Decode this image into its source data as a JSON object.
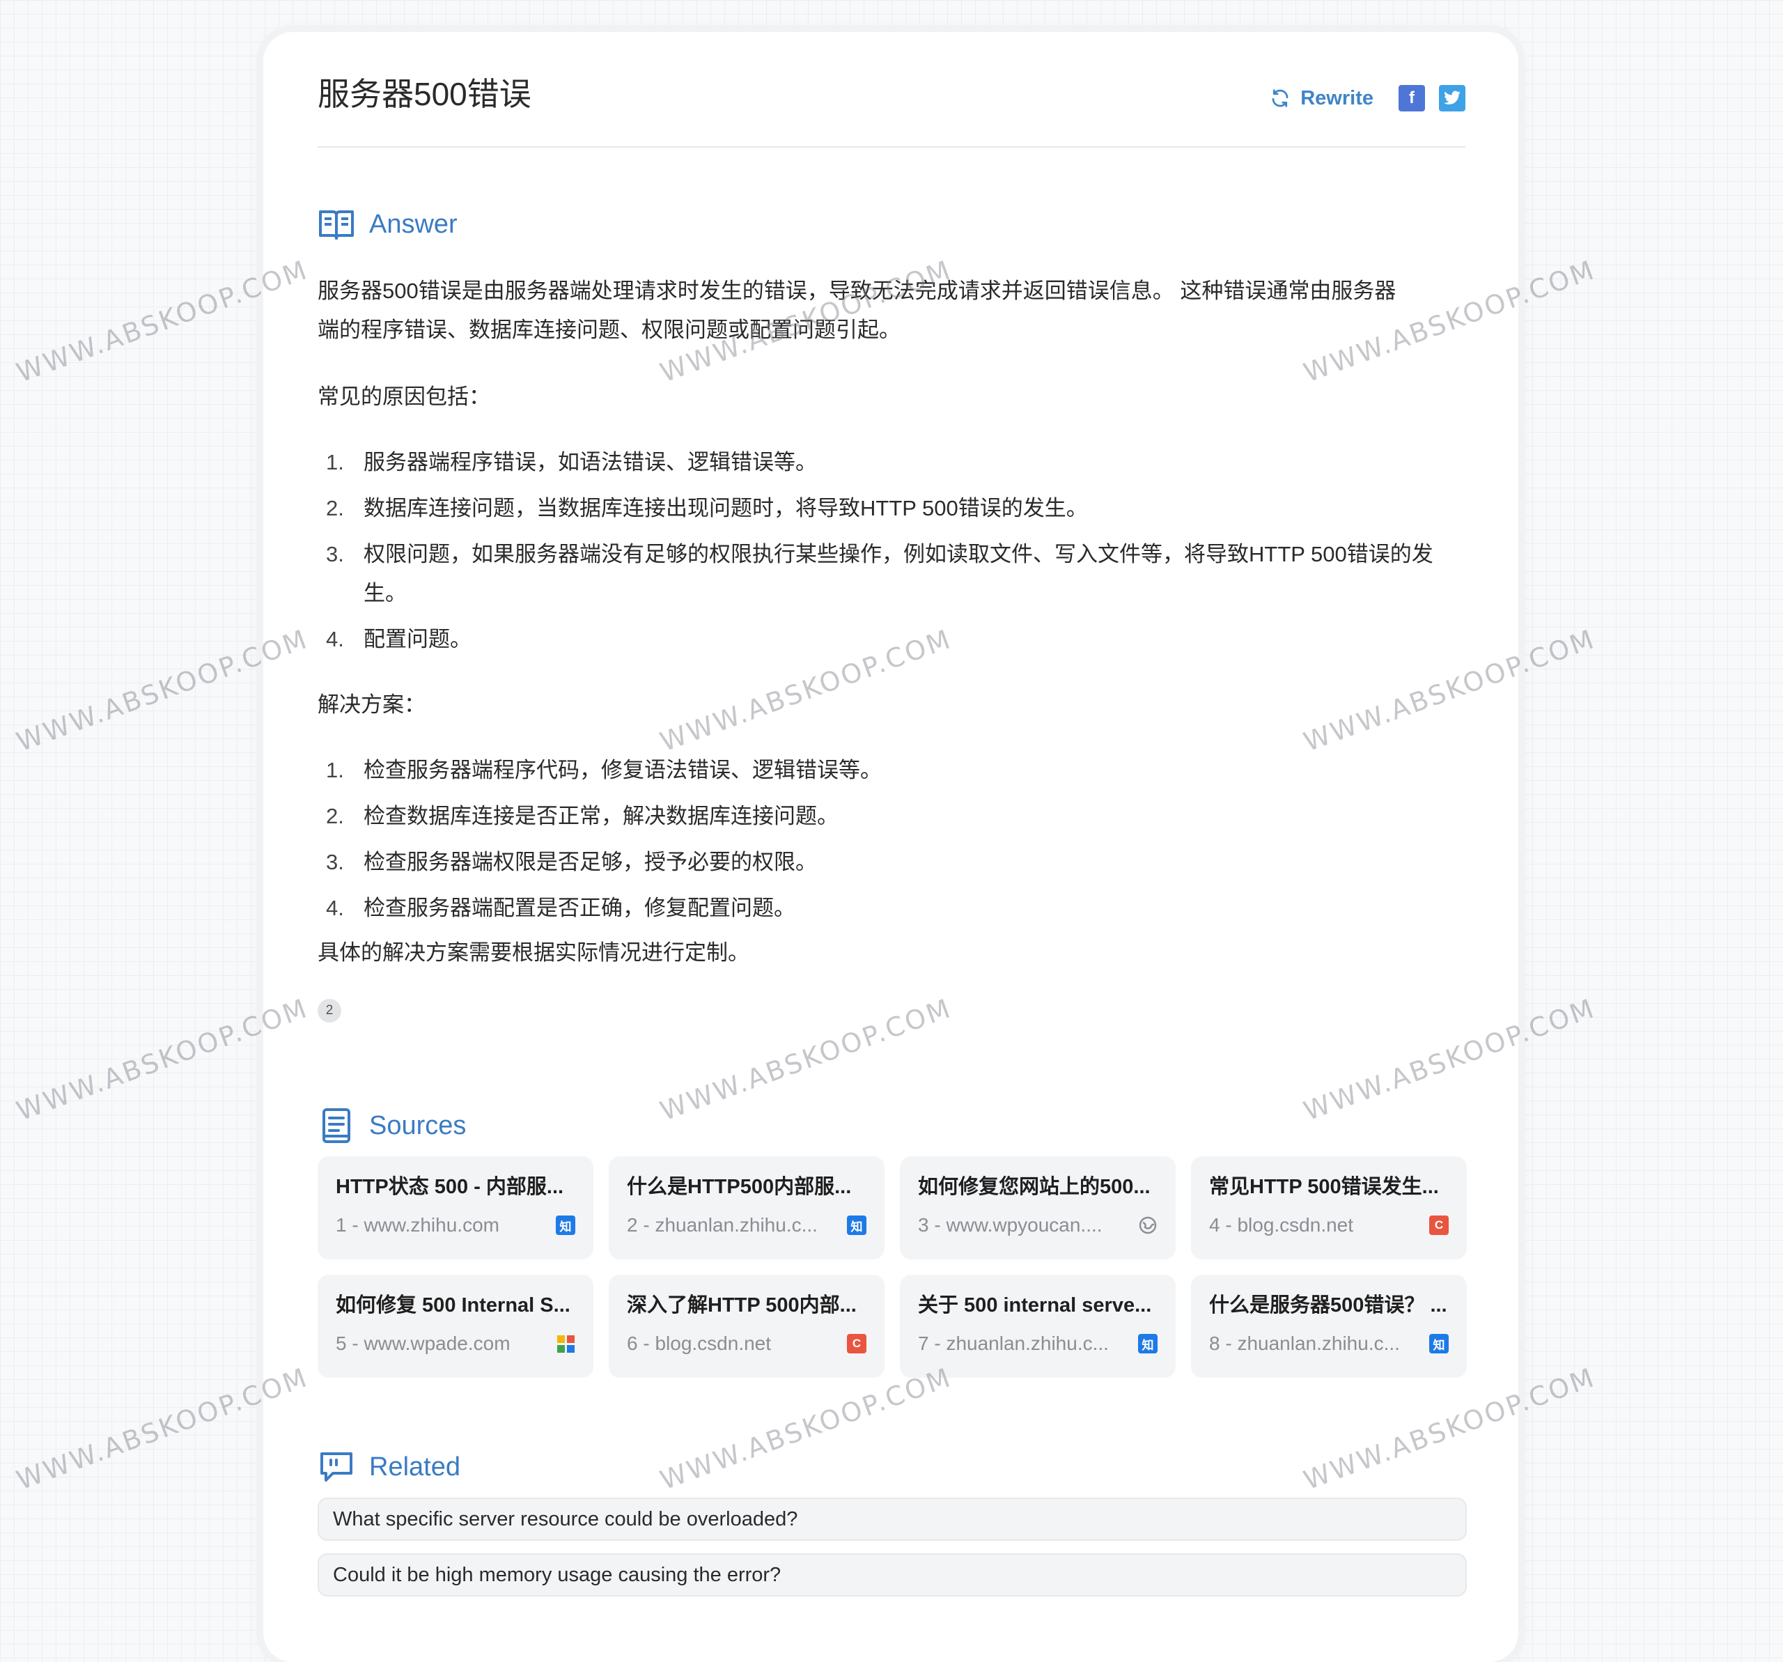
{
  "header": {
    "title": "服务器500错误",
    "rewrite_label": "Rewrite",
    "facebook_glyph": "f",
    "twitter_glyph": "t"
  },
  "answer": {
    "heading": "Answer",
    "intro_line1": "服务器500错误是由服务器端处理请求时发生的错误，导致无法完成请求并返回错误信息。 这种错误通常由服务器",
    "intro_line2": "端的程序错误、数据库连接问题、权限问题或配置问题引起。",
    "causes_label": "常见的原因包括：",
    "causes": [
      {
        "num": "1.",
        "text": "服务器端程序错误，如语法错误、逻辑错误等。"
      },
      {
        "num": "2.",
        "text": "数据库连接问题，当数据库连接出现问题时，将导致HTTP 500错误的发生。"
      },
      {
        "num": "3.",
        "text": "权限问题，如果服务器端没有足够的权限执行某些操作，例如读取文件、写入文件等，将导致HTTP 500错误的发生。"
      },
      {
        "num": "4.",
        "text": "配置问题。"
      }
    ],
    "solutions_label": "解决方案：",
    "solutions": [
      {
        "num": "1.",
        "text": "检查服务器端程序代码，修复语法错误、逻辑错误等。"
      },
      {
        "num": "2.",
        "text": "检查数据库连接是否正常，解决数据库连接问题。"
      },
      {
        "num": "3.",
        "text": "检查服务器端权限是否足够，授予必要的权限。"
      },
      {
        "num": "4.",
        "text": "检查服务器端配置是否正确，修复配置问题。"
      }
    ],
    "conclusion": "具体的解决方案需要根据实际情况进行定制。",
    "citation_badge": "2"
  },
  "sources": {
    "heading": "Sources",
    "items": [
      {
        "title": "HTTP状态 500 - 内部服...",
        "domain": "1 - www.zhihu.com",
        "icon": "zhihu-icon",
        "glyph": "知"
      },
      {
        "title": "什么是HTTP500内部服...",
        "domain": "2 - zhuanlan.zhihu.c...",
        "icon": "zhihu-icon",
        "glyph": "知"
      },
      {
        "title": "如何修复您网站上的500...",
        "domain": "3 - www.wpyoucan....",
        "icon": "globe-icon",
        "glyph": ""
      },
      {
        "title": "常见HTTP 500错误发生...",
        "domain": "4 - blog.csdn.net",
        "icon": "csdn-icon",
        "glyph": "C"
      },
      {
        "title": "如何修复 500 Internal S...",
        "domain": "5 - www.wpade.com",
        "icon": "grid-logo-icon",
        "glyph": ""
      },
      {
        "title": "深入了解HTTP 500内部...",
        "domain": "6 - blog.csdn.net",
        "icon": "csdn-icon",
        "glyph": "C"
      },
      {
        "title": "关于 500 internal serve...",
        "domain": "7 - zhuanlan.zhihu.c...",
        "icon": "zhihu-icon",
        "glyph": "知"
      },
      {
        "title": "什么是服务器500错误？ ...",
        "domain": "8 - zhuanlan.zhihu.c...",
        "icon": "zhihu-icon",
        "glyph": "知"
      }
    ]
  },
  "related": {
    "heading": "Related",
    "items": [
      "What specific server resource could be overloaded?",
      "Could it be high memory usage causing the error?"
    ]
  },
  "watermark": "WWW.ABSKOOP.COM",
  "colors": {
    "accent": "#3a7bc4",
    "rewrite": "#3f84c9",
    "facebook": "#4d76d6",
    "twitter": "#3ea2e7",
    "zhihu": "#1e7ae6",
    "csdn": "#e9553f",
    "card_bg": "#f3f4f6"
  }
}
